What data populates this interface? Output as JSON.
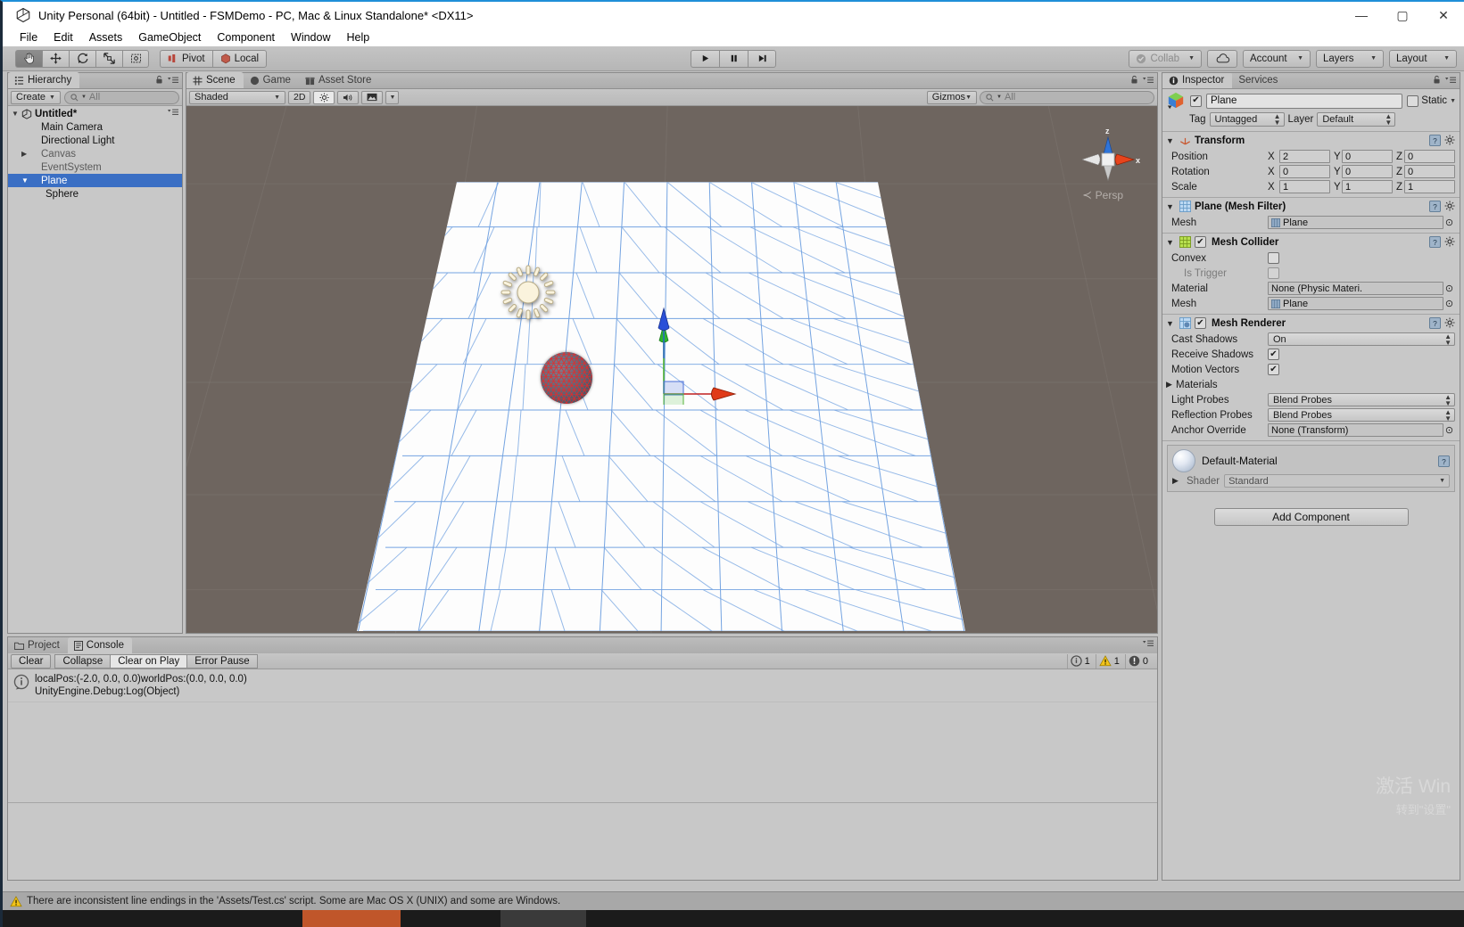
{
  "window": {
    "title": "Unity Personal (64bit) - Untitled - FSMDemo - PC, Mac & Linux Standalone* <DX11>",
    "minimize": "—",
    "maximize": "▢",
    "close": "✕"
  },
  "menubar": {
    "items": [
      "File",
      "Edit",
      "Assets",
      "GameObject",
      "Component",
      "Window",
      "Help"
    ]
  },
  "toolbar": {
    "tools": [
      {
        "name": "hand-tool",
        "glyph": "✋",
        "active": true
      },
      {
        "name": "move-tool",
        "glyph": "✥",
        "active": false
      },
      {
        "name": "rotate-tool",
        "glyph": "⟳",
        "active": false
      },
      {
        "name": "scale-tool",
        "glyph": "⤢",
        "active": false
      },
      {
        "name": "rect-tool",
        "glyph": "⬚",
        "active": false
      }
    ],
    "pivot_label": "Pivot",
    "local_label": "Local",
    "play_label": "▶",
    "pause_label": "❚❚",
    "step_label": "▶❙",
    "collab_label": "Collab",
    "cloud_label": "☁",
    "account_label": "Account",
    "layers_label": "Layers",
    "layout_label": "Layout"
  },
  "hierarchy": {
    "tab_label": "Hierarchy",
    "create_label": "Create",
    "search_placeholder": "All",
    "scene_name": "Untitled*",
    "items": [
      {
        "label": "Main Camera",
        "depth": 1,
        "expandable": false,
        "selected": false,
        "prefab": false
      },
      {
        "label": "Directional Light",
        "depth": 1,
        "expandable": false,
        "selected": false,
        "prefab": false
      },
      {
        "label": "Canvas",
        "depth": 1,
        "expandable": true,
        "selected": false,
        "prefab": true
      },
      {
        "label": "EventSystem",
        "depth": 1,
        "expandable": false,
        "selected": false,
        "prefab": true
      },
      {
        "label": "Plane",
        "depth": 1,
        "expandable": true,
        "selected": true,
        "prefab": false
      },
      {
        "label": "Sphere",
        "depth": 2,
        "expandable": false,
        "selected": false,
        "prefab": false
      }
    ]
  },
  "sceneview": {
    "tabs": [
      {
        "label": "Scene",
        "active": true,
        "icon": "grid-icon"
      },
      {
        "label": "Game",
        "active": false,
        "icon": "gamepad-icon"
      },
      {
        "label": "Asset Store",
        "active": false,
        "icon": "store-icon"
      }
    ],
    "draw_mode": "Shaded",
    "mode_2d": "2D",
    "lighting_toggle": "☀",
    "audio_toggle": "🔊",
    "effects_toggle": "🖼",
    "gizmos_label": "Gizmos",
    "search_placeholder": "All",
    "persp_label": "Persp",
    "axis_x": "x",
    "axis_z": "z"
  },
  "inspector": {
    "tabs": [
      {
        "label": "Inspector",
        "active": true
      },
      {
        "label": "Services",
        "active": false
      }
    ],
    "object_name": "Plane",
    "object_enabled": true,
    "static_label": "Static",
    "static_checked": false,
    "tag_label": "Tag",
    "tag_value": "Untagged",
    "layer_label": "Layer",
    "layer_value": "Default",
    "components": [
      {
        "name": "Transform",
        "icon_color": "#cf5b3c",
        "has_enable_checkbox": false,
        "type": "transform",
        "rows": [
          {
            "label": "Position",
            "x": "2",
            "y": "0",
            "z": "0"
          },
          {
            "label": "Rotation",
            "x": "0",
            "y": "0",
            "z": "0"
          },
          {
            "label": "Scale",
            "x": "1",
            "y": "1",
            "z": "1"
          }
        ]
      },
      {
        "name": "Plane (Mesh Filter)",
        "icon_color": "#6fa8dc",
        "has_enable_checkbox": false,
        "type": "generic",
        "rows": [
          {
            "label": "Mesh",
            "kind": "object",
            "value": "Plane"
          }
        ]
      },
      {
        "name": "Mesh Collider",
        "icon_color": "#97c73c",
        "has_enable_checkbox": true,
        "enabled": true,
        "type": "generic",
        "rows": [
          {
            "label": "Convex",
            "kind": "checkbox",
            "checked": false
          },
          {
            "label": "Is Trigger",
            "kind": "checkbox",
            "checked": false,
            "dim": true
          },
          {
            "label": "Material",
            "kind": "object",
            "value": "None (Physic Materi."
          },
          {
            "label": "Mesh",
            "kind": "object",
            "value": "Plane"
          }
        ]
      },
      {
        "name": "Mesh Renderer",
        "icon_color": "#8fb9e0",
        "has_enable_checkbox": true,
        "enabled": true,
        "type": "generic",
        "rows": [
          {
            "label": "Cast Shadows",
            "kind": "dropdown",
            "value": "On"
          },
          {
            "label": "Receive Shadows",
            "kind": "checkbox",
            "checked": true
          },
          {
            "label": "Motion Vectors",
            "kind": "checkbox",
            "checked": true
          },
          {
            "label": "Materials",
            "kind": "foldout"
          },
          {
            "label": "Light Probes",
            "kind": "dropdown",
            "value": "Blend Probes"
          },
          {
            "label": "Reflection Probes",
            "kind": "dropdown",
            "value": "Blend Probes"
          },
          {
            "label": "Anchor Override",
            "kind": "object",
            "value": "None (Transform)"
          }
        ]
      }
    ],
    "material": {
      "name": "Default-Material",
      "shader_label": "Shader",
      "shader_value": "Standard"
    },
    "add_component_label": "Add Component"
  },
  "console": {
    "tabs": [
      {
        "label": "Project",
        "active": false,
        "icon": "folder-icon"
      },
      {
        "label": "Console",
        "active": true,
        "icon": "console-icon"
      }
    ],
    "buttons": [
      {
        "label": "Clear",
        "active": false
      },
      {
        "label": "Collapse",
        "active": false
      },
      {
        "label": "Clear on Play",
        "active": true
      },
      {
        "label": "Error Pause",
        "active": false
      }
    ],
    "counts": [
      {
        "icon": "info-icon",
        "value": "1"
      },
      {
        "icon": "warning-icon",
        "value": "1"
      },
      {
        "icon": "error-icon",
        "value": "0"
      }
    ],
    "entries": [
      {
        "icon": "info-icon",
        "line1": "localPos:(-2.0, 0.0, 0.0)worldPos:(0.0, 0.0, 0.0)",
        "line2": "UnityEngine.Debug:Log(Object)"
      }
    ]
  },
  "statusbar": {
    "icon": "warning-icon",
    "message": "There are inconsistent line endings in the 'Assets/Test.cs' script. Some are Mac OS X (UNIX) and some are Windows."
  },
  "watermark": {
    "line1": "激活 Win",
    "line2": "转到\"设置\""
  },
  "colors": {
    "selection_blue": "#3a6fc4",
    "scene_bg": "#6e655f",
    "accent_orange": "#cf5b3c",
    "panel_bg": "#c8c8c8"
  }
}
